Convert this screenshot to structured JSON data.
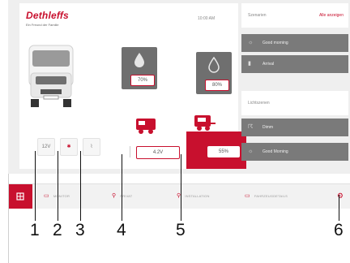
{
  "brand": {
    "logo": "Dethleffs",
    "tagline": "Ein Freund der Familie"
  },
  "clock": "10:00 AM",
  "tanks": [
    {
      "name": "fresh-water",
      "percent": "70%"
    },
    {
      "name": "grey-water",
      "percent": "80%"
    }
  ],
  "battery": {
    "voltage": "4.2V",
    "percent": "55%"
  },
  "controls": {
    "battery_12v": "12V",
    "light": "✱",
    "extra": "⌇"
  },
  "sidebar": {
    "scenes_title": "Szenarien",
    "scenes_action": "Alle anzeigen",
    "scenes": [
      {
        "icon": "☼",
        "label": "Good morning"
      },
      {
        "icon": "▮",
        "label": "Arrival"
      }
    ],
    "lights_title": "Lichtszenen",
    "lights": [
      {
        "icon": "☈",
        "label": "Dimm"
      },
      {
        "icon": "☼",
        "label": "Good Morning"
      }
    ]
  },
  "nav": {
    "items": [
      {
        "icon": "▭",
        "label": "MONITOR"
      },
      {
        "icon": "⚲",
        "label": "PRIVAT"
      },
      {
        "icon": "⚲",
        "label": "INSTALLATION"
      },
      {
        "icon": "▭",
        "label": "FAHRZEUGDETAILS"
      }
    ]
  },
  "callouts": [
    "1",
    "2",
    "3",
    "4",
    "5",
    "6"
  ],
  "colors": {
    "accent": "#c8102e",
    "panel_gray": "#7a7a7a",
    "bg": "#efefef"
  }
}
